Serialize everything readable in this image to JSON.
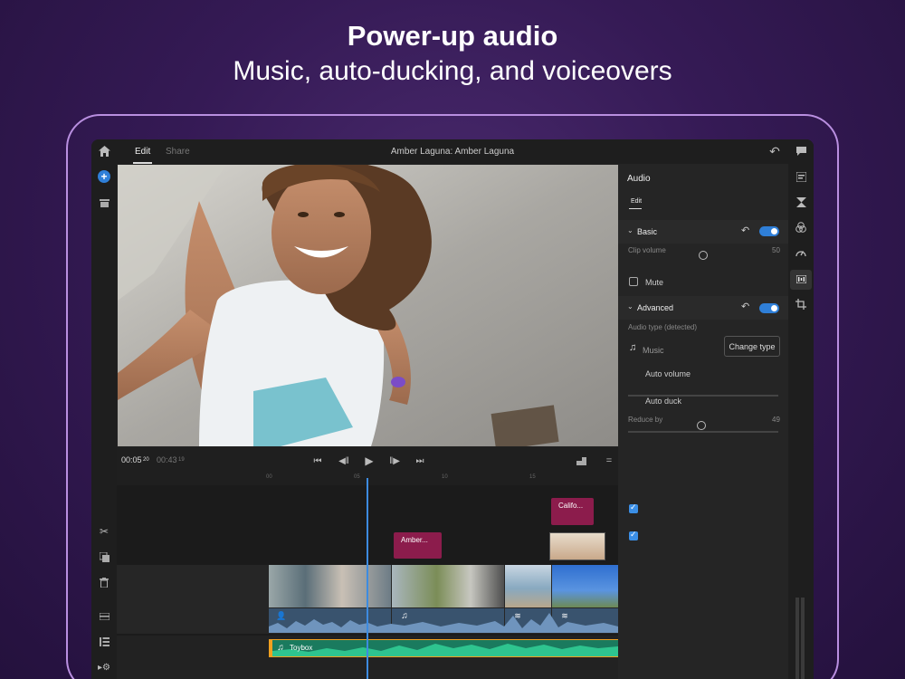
{
  "promo": {
    "headline": "Power-up audio",
    "subhead": "Music, auto-ducking, and voiceovers"
  },
  "topbar": {
    "tabs": [
      {
        "label": "Edit",
        "active": true
      },
      {
        "label": "Share",
        "active": false
      }
    ],
    "title": "Amber Laguna: Amber Laguna"
  },
  "transport": {
    "current_time": "00:05",
    "current_frames": "20",
    "duration": "00:43",
    "duration_frames": "19"
  },
  "ruler": {
    "ticks": [
      "00",
      "05",
      "10",
      "15"
    ]
  },
  "timeline": {
    "title_clips": [
      {
        "label": "Amber..."
      },
      {
        "label": "Califo..."
      }
    ],
    "music_clip": "Toybox",
    "playhead_color": "#3d8be0"
  },
  "panel": {
    "title": "Audio",
    "tab": "Edit",
    "basic": {
      "label": "Basic",
      "enabled": true,
      "clip_volume_label": "Clip volume",
      "clip_volume_value": "50",
      "clip_volume_level": 0.5,
      "mute_label": "Mute",
      "mute_checked": false
    },
    "advanced": {
      "label": "Advanced",
      "enabled": true,
      "audio_type_label": "Audio type (detected)",
      "audio_type_value": "Music",
      "change_type_button": "Change type",
      "auto_volume_label": "Auto volume",
      "auto_volume_checked": true,
      "auto_duck_label": "Auto duck",
      "auto_duck_checked": true,
      "reduce_by_label": "Reduce by",
      "reduce_by_value": "49",
      "reduce_by_level": 0.49
    }
  },
  "colors": {
    "accent": "#2f7fd8",
    "title_clip": "#8c1c4c",
    "music_track": "#1e9a74",
    "music_edge": "#f0a020"
  }
}
